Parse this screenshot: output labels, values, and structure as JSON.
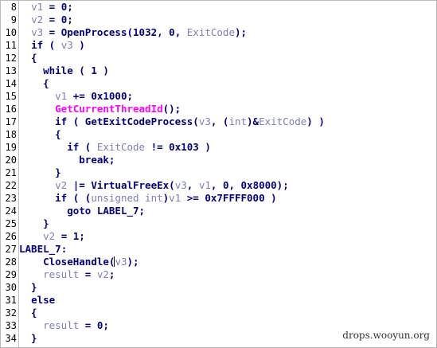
{
  "editor": {
    "lines": [
      {
        "num": "8",
        "tokens": [
          {
            "t": "  "
          },
          {
            "t": "v1",
            "c": "v"
          },
          {
            "t": " = 0;",
            "c": "p"
          }
        ]
      },
      {
        "num": "9",
        "tokens": [
          {
            "t": "  "
          },
          {
            "t": "v2",
            "c": "v"
          },
          {
            "t": " = 0;",
            "c": "p"
          }
        ]
      },
      {
        "num": "10",
        "tokens": [
          {
            "t": "  "
          },
          {
            "t": "v3",
            "c": "v"
          },
          {
            "t": " = ",
            "c": "p"
          },
          {
            "t": "OpenProcess",
            "c": "f"
          },
          {
            "t": "(1032, 0, ",
            "c": "p"
          },
          {
            "t": "ExitCode",
            "c": "v"
          },
          {
            "t": ");",
            "c": "p"
          }
        ]
      },
      {
        "num": "11",
        "tokens": [
          {
            "t": "  "
          },
          {
            "t": "if",
            "c": "k"
          },
          {
            "t": " ( ",
            "c": "p"
          },
          {
            "t": "v3",
            "c": "v"
          },
          {
            "t": " )",
            "c": "p"
          }
        ]
      },
      {
        "num": "12",
        "tokens": [
          {
            "t": "  {",
            "c": "p"
          }
        ]
      },
      {
        "num": "13",
        "tokens": [
          {
            "t": "    "
          },
          {
            "t": "while",
            "c": "k"
          },
          {
            "t": " ( 1 )",
            "c": "p"
          }
        ]
      },
      {
        "num": "14",
        "tokens": [
          {
            "t": "    {",
            "c": "p"
          }
        ]
      },
      {
        "num": "15",
        "tokens": [
          {
            "t": "      "
          },
          {
            "t": "v1",
            "c": "v"
          },
          {
            "t": " += 0x1000;",
            "c": "p"
          }
        ]
      },
      {
        "num": "16",
        "tokens": [
          {
            "t": "      "
          },
          {
            "t": "GetCurrentThreadId",
            "c": "m"
          },
          {
            "t": "();",
            "c": "p"
          }
        ]
      },
      {
        "num": "17",
        "tokens": [
          {
            "t": "      "
          },
          {
            "t": "if",
            "c": "k"
          },
          {
            "t": " ( ",
            "c": "p"
          },
          {
            "t": "GetExitCodeProcess",
            "c": "f"
          },
          {
            "t": "(",
            "c": "p"
          },
          {
            "t": "v3",
            "c": "v"
          },
          {
            "t": ", (",
            "c": "p"
          },
          {
            "t": "int",
            "c": "t"
          },
          {
            "t": ")&",
            "c": "p"
          },
          {
            "t": "ExitCode",
            "c": "v"
          },
          {
            "t": ") )",
            "c": "p"
          }
        ]
      },
      {
        "num": "18",
        "tokens": [
          {
            "t": "      {",
            "c": "p"
          }
        ]
      },
      {
        "num": "19",
        "tokens": [
          {
            "t": "        "
          },
          {
            "t": "if",
            "c": "k"
          },
          {
            "t": " ( ",
            "c": "p"
          },
          {
            "t": "ExitCode",
            "c": "v"
          },
          {
            "t": " != 0x103 )",
            "c": "p"
          }
        ]
      },
      {
        "num": "20",
        "tokens": [
          {
            "t": "          "
          },
          {
            "t": "break",
            "c": "k"
          },
          {
            "t": ";",
            "c": "p"
          }
        ]
      },
      {
        "num": "21",
        "tokens": [
          {
            "t": "      }",
            "c": "p"
          }
        ]
      },
      {
        "num": "22",
        "tokens": [
          {
            "t": "      "
          },
          {
            "t": "v2",
            "c": "v"
          },
          {
            "t": " |= ",
            "c": "p"
          },
          {
            "t": "VirtualFreeEx",
            "c": "f"
          },
          {
            "t": "(",
            "c": "p"
          },
          {
            "t": "v3",
            "c": "v"
          },
          {
            "t": ", ",
            "c": "p"
          },
          {
            "t": "v1",
            "c": "v"
          },
          {
            "t": ", 0, 0x8000);",
            "c": "p"
          }
        ]
      },
      {
        "num": "23",
        "tokens": [
          {
            "t": "      "
          },
          {
            "t": "if",
            "c": "k"
          },
          {
            "t": " ( (",
            "c": "p"
          },
          {
            "t": "unsigned int",
            "c": "t"
          },
          {
            "t": ")",
            "c": "p"
          },
          {
            "t": "v1",
            "c": "v"
          },
          {
            "t": " >= 0x7FFFF000 )",
            "c": "p"
          }
        ]
      },
      {
        "num": "24",
        "tokens": [
          {
            "t": "        "
          },
          {
            "t": "goto",
            "c": "k"
          },
          {
            "t": " ",
            "c": "p"
          },
          {
            "t": "LABEL_7",
            "c": "l"
          },
          {
            "t": ";",
            "c": "p"
          }
        ]
      },
      {
        "num": "25",
        "tokens": [
          {
            "t": "    }",
            "c": "p"
          }
        ]
      },
      {
        "num": "26",
        "tokens": [
          {
            "t": "    "
          },
          {
            "t": "v2",
            "c": "v"
          },
          {
            "t": " = 1;",
            "c": "p"
          }
        ]
      },
      {
        "num": "27",
        "tokens": [
          {
            "t": "LABEL_7",
            "c": "l"
          },
          {
            "t": ":",
            "c": "p"
          }
        ]
      },
      {
        "num": "28",
        "tokens": [
          {
            "t": "    "
          },
          {
            "t": "CloseHandle",
            "c": "f"
          },
          {
            "t": "(",
            "c": "p"
          },
          {
            "t": "",
            "c": "caret"
          },
          {
            "t": "v3",
            "c": "v"
          },
          {
            "t": ");",
            "c": "p"
          }
        ]
      },
      {
        "num": "29",
        "tokens": [
          {
            "t": "    "
          },
          {
            "t": "result",
            "c": "v"
          },
          {
            "t": " = ",
            "c": "p"
          },
          {
            "t": "v2",
            "c": "v"
          },
          {
            "t": ";",
            "c": "p"
          }
        ]
      },
      {
        "num": "30",
        "tokens": [
          {
            "t": "  }",
            "c": "p"
          }
        ]
      },
      {
        "num": "31",
        "tokens": [
          {
            "t": "  "
          },
          {
            "t": "else",
            "c": "k"
          }
        ]
      },
      {
        "num": "32",
        "tokens": [
          {
            "t": "  {",
            "c": "p"
          }
        ]
      },
      {
        "num": "33",
        "tokens": [
          {
            "t": "    "
          },
          {
            "t": "result",
            "c": "v"
          },
          {
            "t": " = 0;",
            "c": "p"
          }
        ]
      },
      {
        "num": "34",
        "tokens": [
          {
            "t": "  }",
            "c": "p"
          }
        ]
      }
    ]
  },
  "watermark": "drops.wooyun.org",
  "colors": {
    "keyword": "#000080",
    "variable": "#7d7dbd",
    "function": "#000080",
    "highlighted_function": "#ff00ff",
    "punctuation": "#000080",
    "line_number": "#000000",
    "background": "#ffffff"
  }
}
